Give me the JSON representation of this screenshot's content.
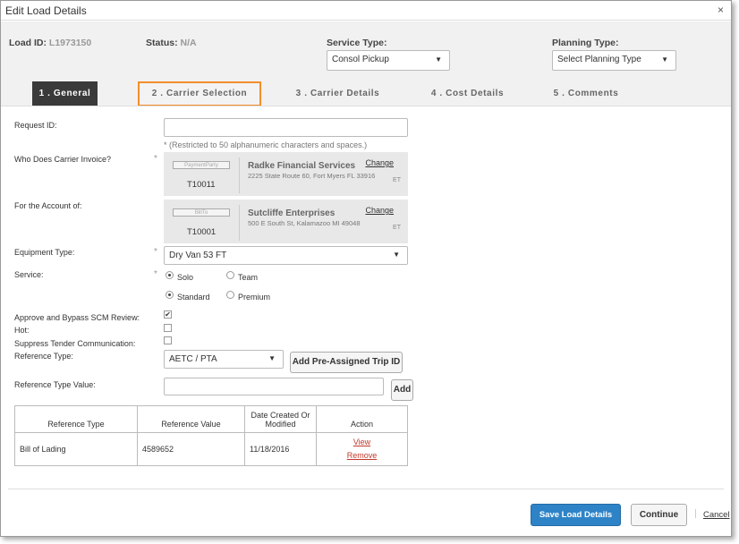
{
  "window": {
    "title": "Edit Load Details",
    "close_glyph": "×"
  },
  "header": {
    "load_id_label": "Load ID:",
    "load_id_value": "L1973150",
    "status_label": "Status:",
    "status_value": "N/A",
    "service_type_label": "Service Type:",
    "service_type_value": "Consol Pickup",
    "planning_type_label": "Planning Type:",
    "planning_type_value": "Select Planning Type"
  },
  "tabs": [
    "1 . General",
    "2 . Carrier Selection",
    "3 . Carrier Details",
    "4 . Cost Details",
    "5 . Comments"
  ],
  "form": {
    "request_id_label": "Request ID:",
    "request_id_note": "* (Restricted to 50 alphanumeric characters and spaces.)",
    "invoice_label": "Who Does Carrier Invoice?",
    "account_label": "For the Account of:",
    "required_mark": "*",
    "payment_party": {
      "box": "PaymentParty",
      "id": "T10011",
      "name": "Radke Financial Services",
      "address": "2225 State Route 60, Fort Myers FL 33916",
      "tz": "ET",
      "change": "Change"
    },
    "bill_to": {
      "box": "BillTo",
      "id": "T10001",
      "name": "Sutcliffe Enterprises",
      "address": "500 E South St, Kalamazoo MI 49048",
      "tz": "ET",
      "change": "Change"
    },
    "equipment_label": "Equipment Type:",
    "equipment_value": "Dry Van 53 FT",
    "service_label": "Service:",
    "service_opt1": "Solo",
    "service_opt2": "Team",
    "level_opt1": "Standard",
    "level_opt2": "Premium",
    "approve_label": "Approve and Bypass SCM Review:",
    "hot_label": "Hot:",
    "suppress_label": "Suppress Tender Communication:",
    "ref_type_label": "Reference Type:",
    "ref_type_value": "AETC / PTA",
    "add_trip_button": "Add Pre-Assigned Trip ID",
    "ref_value_label": "Reference Type Value:",
    "add_button": "Add"
  },
  "table": {
    "headers": [
      "Reference Type",
      "Reference Value",
      "Date Created Or Modified",
      "Action"
    ],
    "rows": [
      {
        "type": "Bill of Lading",
        "value": "4589652",
        "date": "11/18/2016",
        "view": "View",
        "remove": "Remove"
      }
    ]
  },
  "footer": {
    "save": "Save Load Details",
    "continue": "Continue",
    "cancel": "Cancel"
  },
  "colors": {
    "accent": "#2e83c7",
    "tab_highlight": "#f28e2b",
    "active_tab": "#3a3a3a",
    "link_red": "#c0392b"
  }
}
